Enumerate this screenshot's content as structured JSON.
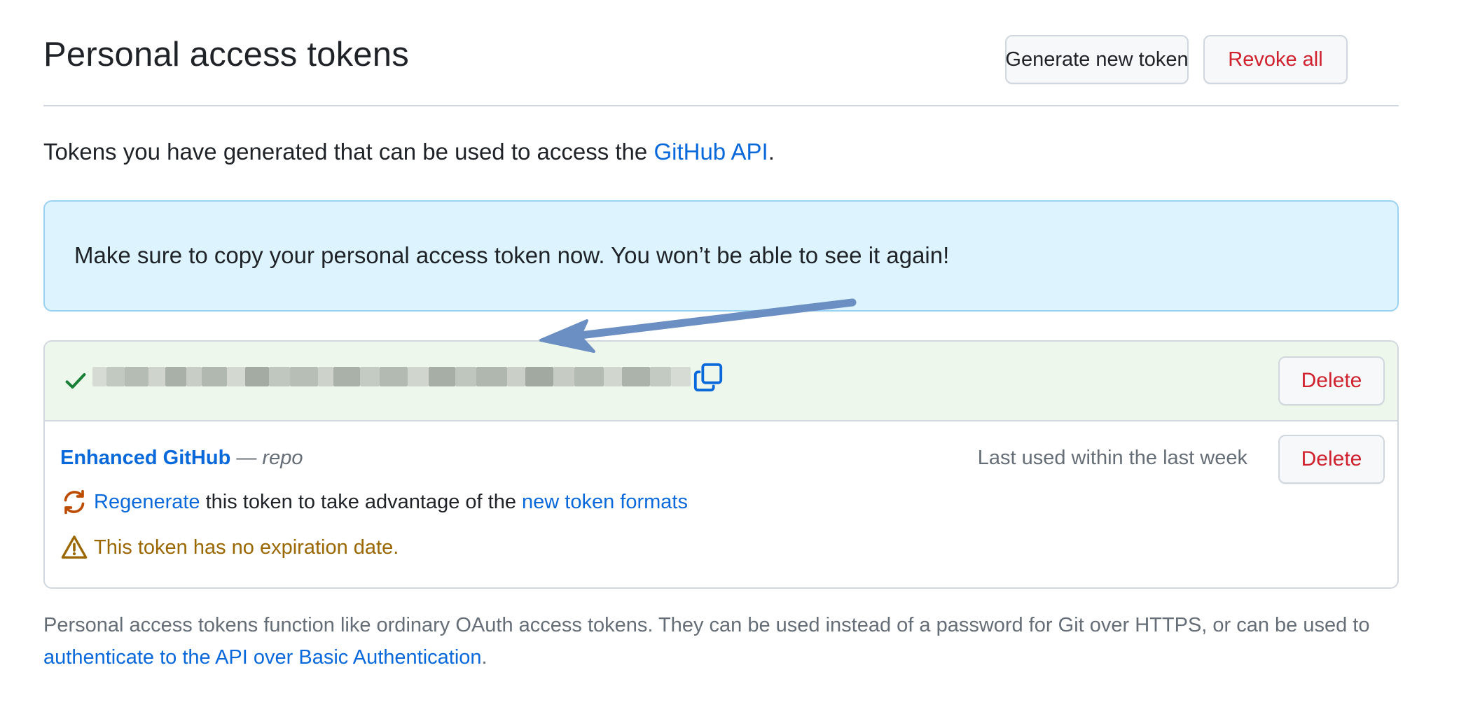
{
  "header": {
    "title": "Personal access tokens",
    "generate_button": "Generate new token",
    "revoke_all_button": "Revoke all"
  },
  "intro": {
    "text": "Tokens you have generated that can be used to access the ",
    "link": "GitHub API",
    "suffix": "."
  },
  "flash": {
    "message": "Make sure to copy your personal access token now. You won’t be able to see it again!"
  },
  "new_token": {
    "value_state": "redacted",
    "delete_label": "Delete",
    "icons": [
      "check-icon",
      "copy-icon"
    ]
  },
  "token": {
    "name": "Enhanced GitHub",
    "separator": "—",
    "scope": "repo",
    "last_used": "Last used within the last week",
    "delete_label": "Delete",
    "regenerate_link": "Regenerate",
    "regenerate_text": " this token to take advantage of the ",
    "formats_link": "new token formats",
    "warning": "This token has no expiration date."
  },
  "footer": {
    "text": "Personal access tokens function like ordinary OAuth access tokens. They can be used instead of a password for Git over HTTPS, or can be used to ",
    "link": "authenticate to the API over Basic Authentication",
    "suffix": "."
  },
  "colors": {
    "link": "#0969da",
    "danger": "#cf222e",
    "success": "#1a7f37",
    "warning": "#9a6700",
    "flash_bg": "#ddf4ff",
    "token_row_bg": "#eef7ec",
    "annotation_arrow": "#6b8fc2"
  }
}
